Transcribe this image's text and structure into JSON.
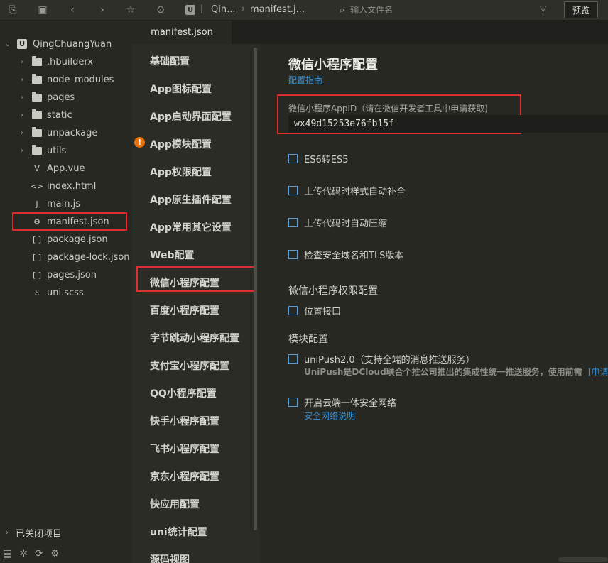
{
  "toolbar": {
    "breadcrumb_project": "Qin...",
    "breadcrumb_file": "manifest.j...",
    "search_placeholder": "输入文件名",
    "preview_label": "预览"
  },
  "project": {
    "root": "QingChuangYuan",
    "items": [
      {
        "label": ".hbuilderx",
        "type": "folder"
      },
      {
        "label": "node_modules",
        "type": "folder"
      },
      {
        "label": "pages",
        "type": "folder"
      },
      {
        "label": "static",
        "type": "folder"
      },
      {
        "label": "unpackage",
        "type": "folder"
      },
      {
        "label": "utils",
        "type": "folder"
      },
      {
        "label": "App.vue",
        "type": "vue"
      },
      {
        "label": "index.html",
        "type": "html"
      },
      {
        "label": "main.js",
        "type": "js"
      },
      {
        "label": "manifest.json",
        "type": "manifest"
      },
      {
        "label": "package.json",
        "type": "json"
      },
      {
        "label": "package-lock.json",
        "type": "json"
      },
      {
        "label": "pages.json",
        "type": "json"
      },
      {
        "label": "uni.scss",
        "type": "scss"
      }
    ],
    "closed_projects": "已关闭项目"
  },
  "tab": {
    "label": "manifest.json"
  },
  "nav": {
    "items": [
      "基础配置",
      "App图标配置",
      "App启动界面配置",
      "App模块配置",
      "App权限配置",
      "App原生插件配置",
      "App常用其它设置",
      "Web配置",
      "微信小程序配置",
      "百度小程序配置",
      "字节跳动小程序配置",
      "支付宝小程序配置",
      "QQ小程序配置",
      "快手小程序配置",
      "飞书小程序配置",
      "京东小程序配置",
      "快应用配置",
      "uni统计配置",
      "源码视图"
    ]
  },
  "content": {
    "title": "微信小程序配置",
    "guide_link": "配置指南",
    "appid_label": "微信小程序AppID（请在微信开发者工具中申请获取)",
    "appid_value": "wx49d15253e76fb15f",
    "options": [
      "ES6转ES5",
      "上传代码时样式自动补全",
      "上传代码时自动压缩",
      "检查安全域名和TLS版本"
    ],
    "permission_section": "微信小程序权限配置",
    "permission_option": "位置接口",
    "module_section": "模块配置",
    "uni_push_label": "uniPush2.0（支持全端的消息推送服务）",
    "uni_push_desc": "UniPush是DCloud联合个推公司推出的集成性统一推送服务，使用前需",
    "uni_push_link": "[申请开",
    "secure_net_label": "开启云端一体安全网络",
    "secure_net_link": "安全网络说明"
  }
}
